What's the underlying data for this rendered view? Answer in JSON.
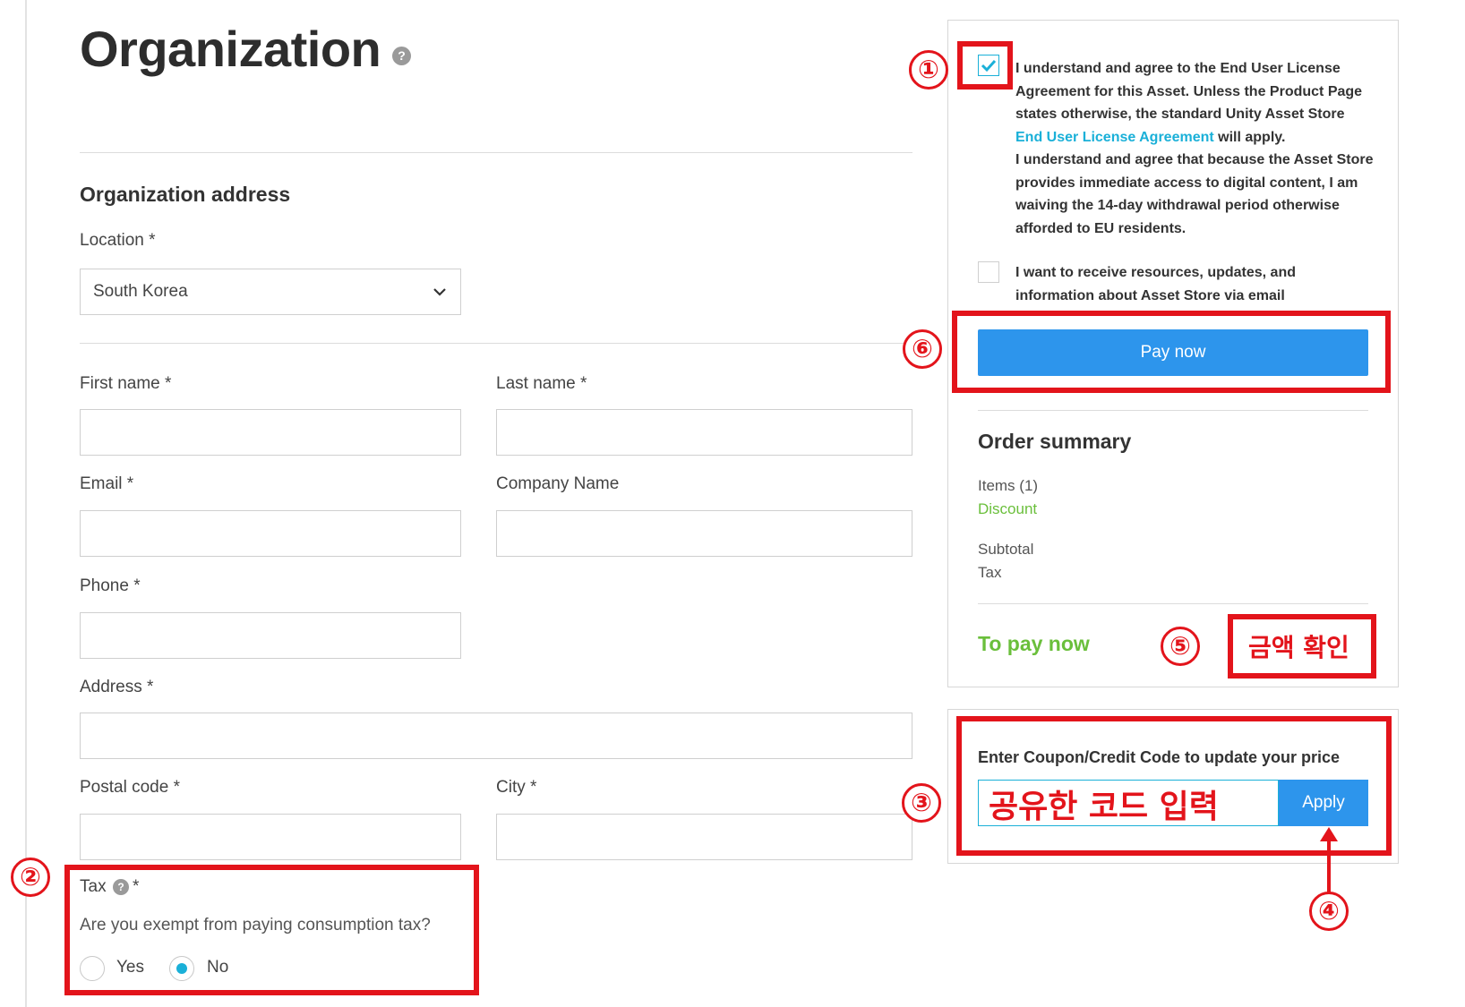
{
  "header": {
    "title": "Organization"
  },
  "address_section": {
    "title": "Organization address",
    "location_label": "Location *",
    "location_value": "South Korea"
  },
  "form": {
    "first_name_label": "First name *",
    "last_name_label": "Last name *",
    "email_label": "Email *",
    "company_label": "Company Name",
    "phone_label": "Phone *",
    "address_label": "Address *",
    "postal_label": "Postal code *",
    "city_label": "City *"
  },
  "tax": {
    "label": "Tax",
    "required_mark": "*",
    "question": "Are you exempt from paying consumption tax?",
    "option_yes": "Yes",
    "option_no": "No",
    "selected": "No"
  },
  "agreement": {
    "eula_text_1": "I understand and agree to the End User License Agreement for this Asset. Unless the Product Page states otherwise, the standard Unity Asset Store ",
    "eula_link": "End User License Agreement",
    "eula_text_2": " will apply.",
    "eula_text_3": "I understand and agree that because the Asset Store provides immediate access to digital content, I am waiving the 14-day withdrawal period otherwise afforded to EU residents.",
    "eula_checked": true,
    "newsletter_text": "I want to receive resources, updates, and information about Asset Store via email",
    "newsletter_checked": false
  },
  "pay_button_label": "Pay now",
  "summary": {
    "title": "Order summary",
    "items": "Items (1)",
    "discount": "Discount",
    "subtotal": "Subtotal",
    "tax": "Tax",
    "to_pay": "To pay now"
  },
  "coupon": {
    "title": "Enter Coupon/Credit Code to update your price",
    "apply_label": "Apply"
  },
  "annotations": {
    "step_1": "①",
    "step_2": "②",
    "step_3": "③",
    "step_4": "④",
    "step_5": "⑤",
    "step_6": "⑥",
    "coupon_hint": "공유한 코드 입력",
    "amount_hint": "금액 확인"
  },
  "colors": {
    "accent_blue": "#2d95ec",
    "link_teal": "#1ab0d8",
    "green": "#6abf3b",
    "annotation_red": "#e3141b"
  }
}
